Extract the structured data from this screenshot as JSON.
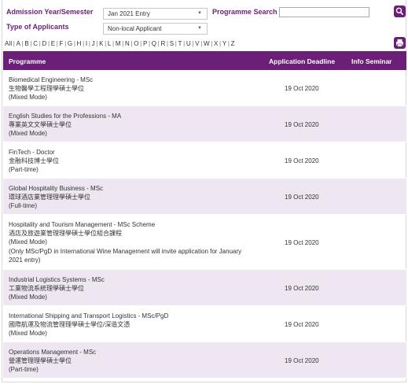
{
  "filters": {
    "admission_label": "Admission Year/Semester",
    "admission_value": "Jan 2021 Entry",
    "applicant_label": "Type of Applicants",
    "applicant_value": "Non-local Applicant",
    "search_label": "Programme Search",
    "search_value": ""
  },
  "alphabet": [
    "All",
    "A",
    "B",
    "C",
    "D",
    "E",
    "F",
    "G",
    "H",
    "I",
    "J",
    "K",
    "L",
    "M",
    "N",
    "O",
    "P",
    "Q",
    "R",
    "S",
    "T",
    "U",
    "V",
    "W",
    "X",
    "Y",
    "Z"
  ],
  "table": {
    "headers": {
      "programme": "Programme",
      "deadline": "Application Deadline",
      "seminar": "Info Seminar"
    },
    "rows": [
      {
        "name": "Biomedical Engineering - MSc",
        "chinese": "生物醫學工程理學碩士學位",
        "mode": "(Mixed Mode)",
        "note": "",
        "deadline": "19 Oct 2020",
        "seminar": ""
      },
      {
        "name": "English Studies for the Professions - MA",
        "chinese": "專業英文文學碩士學位",
        "mode": "(Mixed Mode)",
        "note": "",
        "deadline": "19 Oct 2020",
        "seminar": ""
      },
      {
        "name": "FinTech - Doctor",
        "chinese": "金融科技博士學位",
        "mode": "(Part-time)",
        "note": "",
        "deadline": "19 Oct 2020",
        "seminar": ""
      },
      {
        "name": "Global Hospitality Business - MSc",
        "chinese": "環球酒店業管理理學碩士學位",
        "mode": "(Full-time)",
        "note": "",
        "deadline": "19 Oct 2020",
        "seminar": ""
      },
      {
        "name": "Hospitality and Tourism Management - MSc Scheme",
        "chinese": "酒店及旅遊業管理理學碩士學位組合課程",
        "mode": "(Mixed Mode)",
        "note": "(Only MSc/PgD in International Wine Management will invite application for January 2021 entry)",
        "deadline": "19 Oct 2020",
        "seminar": ""
      },
      {
        "name": "Industrial Logistics Systems - MSc",
        "chinese": "工業物流系統理學碩士學位",
        "mode": "(Mixed Mode)",
        "note": "",
        "deadline": "19 Oct 2020",
        "seminar": ""
      },
      {
        "name": "International Shipping and Transport Logistics - MSc/PgD",
        "chinese": "國際航運及物流管理理學碩士學位/深造文憑",
        "mode": "(Mixed Mode)",
        "note": "",
        "deadline": "19 Oct 2020",
        "seminar": ""
      },
      {
        "name": "Operations Management - MSc",
        "chinese": "營運管理理學碩士學位",
        "mode": "(Part-time)",
        "note": "",
        "deadline": "19 Oct 2020",
        "seminar": ""
      }
    ]
  },
  "icons": {
    "search": "search-icon",
    "print": "print-icon"
  },
  "colors": {
    "accent": "#6b1f78",
    "row_shade": "#eee6f0"
  }
}
